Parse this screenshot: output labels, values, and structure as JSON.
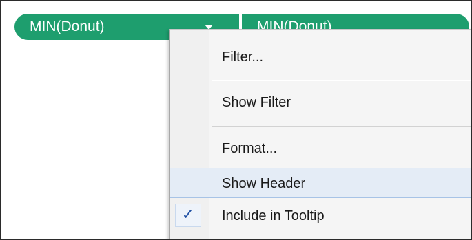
{
  "pills": {
    "left_label": "MIN(Donut)",
    "right_label": "MIN(Donut)",
    "color": "#1e9e6e"
  },
  "context_menu": {
    "items": [
      {
        "label": "Filter...",
        "checked": false,
        "highlighted": false
      },
      {
        "label": "Show Filter",
        "checked": false,
        "highlighted": false
      },
      {
        "label": "Format...",
        "checked": false,
        "highlighted": false
      },
      {
        "label": "Show Header",
        "checked": false,
        "highlighted": true
      },
      {
        "label": "Include in Tooltip",
        "checked": true,
        "highlighted": false
      }
    ],
    "check_symbol": "✓",
    "highlight_color": "#e4ecf6"
  },
  "icons": {
    "dropdown": "chevron-down-icon",
    "check": "checkmark-icon"
  }
}
